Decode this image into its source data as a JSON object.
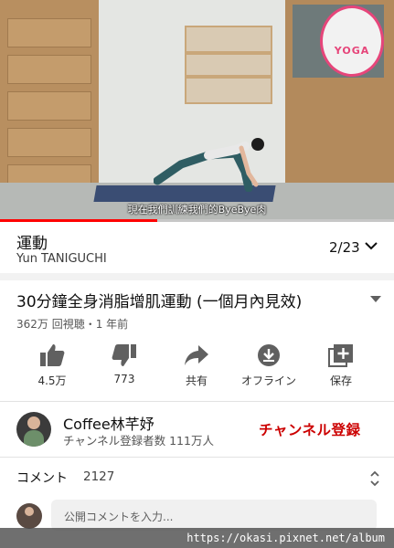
{
  "video": {
    "subtitle": "現在我們訓練我們的ByeBye肉",
    "logo_text": "YOGA",
    "progress_percent": 40
  },
  "playlist": {
    "title": "運動",
    "owner": "Yun TANIGUCHI",
    "position": "2/23"
  },
  "video_info": {
    "title": "30分鐘全身消脂增肌運動 (一個月內見效)",
    "meta": "362万 回視聴・1 年前"
  },
  "actions": [
    {
      "label": "4.5万",
      "icon": "thumbs-up-icon"
    },
    {
      "label": "773",
      "icon": "thumbs-down-icon"
    },
    {
      "label": "共有",
      "icon": "share-icon"
    },
    {
      "label": "オフライン",
      "icon": "download-icon"
    },
    {
      "label": "保存",
      "icon": "add-to-playlist-icon"
    }
  ],
  "channel": {
    "name": "Coffee林芊妤",
    "subscribers": "チャンネル登録者数 111万人",
    "subscribe_label": "チャンネル登録"
  },
  "comments": {
    "label": "コメント",
    "count": "2127",
    "placeholder": "公開コメントを入力..."
  },
  "watermark": "https://okasi.pixnet.net/album",
  "colors": {
    "accent": "#ff0000",
    "subscribe": "#cc0000",
    "icon": "#606060"
  }
}
